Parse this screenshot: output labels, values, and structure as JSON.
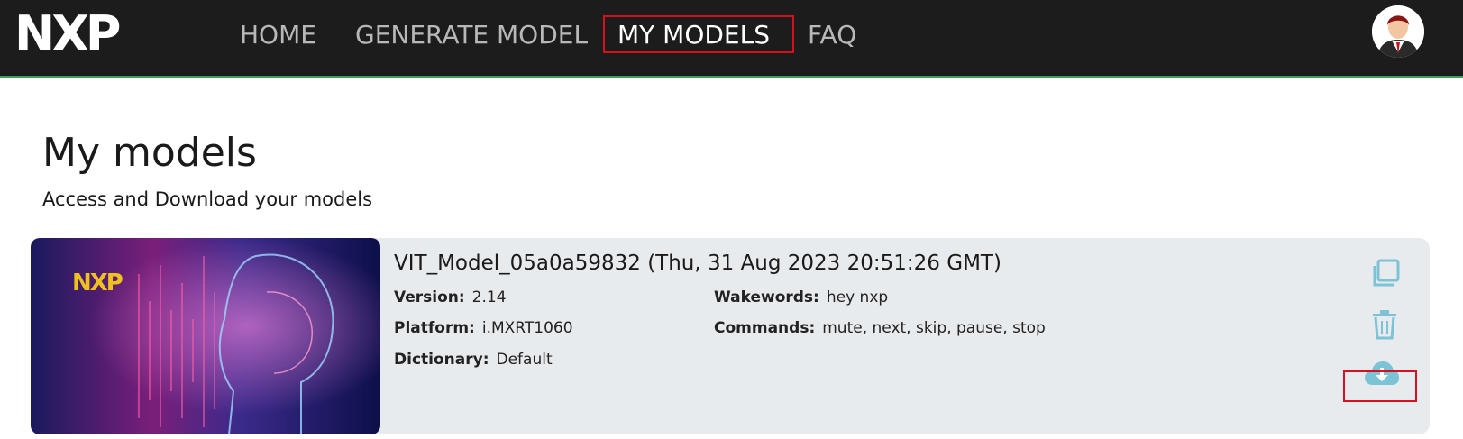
{
  "nav": {
    "items": [
      {
        "label": "HOME"
      },
      {
        "label": "GENERATE MODEL"
      },
      {
        "label": "MY MODELS"
      },
      {
        "label": "FAQ"
      }
    ],
    "active": "MY MODELS"
  },
  "page": {
    "title": "My models",
    "subtitle": "Access and Download your models"
  },
  "models": [
    {
      "title": "VIT_Model_05a0a59832 (Thu, 31 Aug 2023 20:51:26 GMT)",
      "version_label": "Version:",
      "version": "2.14",
      "platform_label": "Platform:",
      "platform": "i.MXRT1060",
      "dictionary_label": "Dictionary:",
      "dictionary": "Default",
      "wakewords_label": "Wakewords:",
      "wakewords": "hey nxp",
      "commands_label": "Commands:",
      "commands": "mute, next, skip, pause, stop",
      "actions": [
        "copy-icon",
        "trash-icon",
        "cloud-download-icon"
      ]
    }
  ],
  "colors": {
    "navbar_bg": "#1c1c1c",
    "accent_line": "#3aa35a",
    "highlight_box": "#d8101e",
    "icon_teal": "#7cc3d6",
    "card_bg": "#e8ebee"
  }
}
